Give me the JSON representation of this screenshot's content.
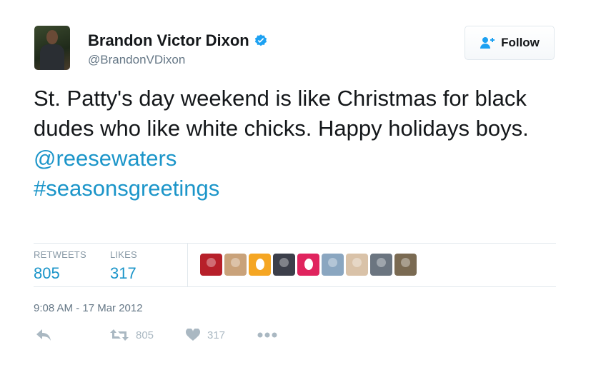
{
  "user": {
    "name": "Brandon Victor Dixon",
    "handle": "@BrandonVDixon",
    "verified": true
  },
  "follow_button": {
    "label": "Follow"
  },
  "tweet": {
    "text": "St. Patty's day weekend is like Christmas for black dudes who like white chicks. Happy holidays boys.",
    "mention": "@reesewaters",
    "hashtag": "#seasonsgreetings"
  },
  "stats": {
    "retweets_label": "RETWEETS",
    "retweets": "805",
    "likes_label": "LIKES",
    "likes": "317"
  },
  "likers": [
    {
      "kind": "photo",
      "color": "#b7202a"
    },
    {
      "kind": "photo",
      "color": "#c9a27a"
    },
    {
      "kind": "egg",
      "color": "#f5a623"
    },
    {
      "kind": "photo",
      "color": "#3c3f4a"
    },
    {
      "kind": "egg",
      "color": "#e0245e"
    },
    {
      "kind": "photo",
      "color": "#8aa6c0"
    },
    {
      "kind": "photo",
      "color": "#d9c2a8"
    },
    {
      "kind": "photo",
      "color": "#6b7580"
    },
    {
      "kind": "photo",
      "color": "#7a6a52"
    }
  ],
  "timestamp": "9:08 AM - 17 Mar 2012",
  "actions": {
    "reply_icon": "reply-icon",
    "retweet_count": "805",
    "like_count": "317",
    "more_icon": "more-icon"
  },
  "colors": {
    "link": "#1b95c9",
    "text": "#14171a",
    "muted": "#657786",
    "verified": "#1da1f2"
  }
}
